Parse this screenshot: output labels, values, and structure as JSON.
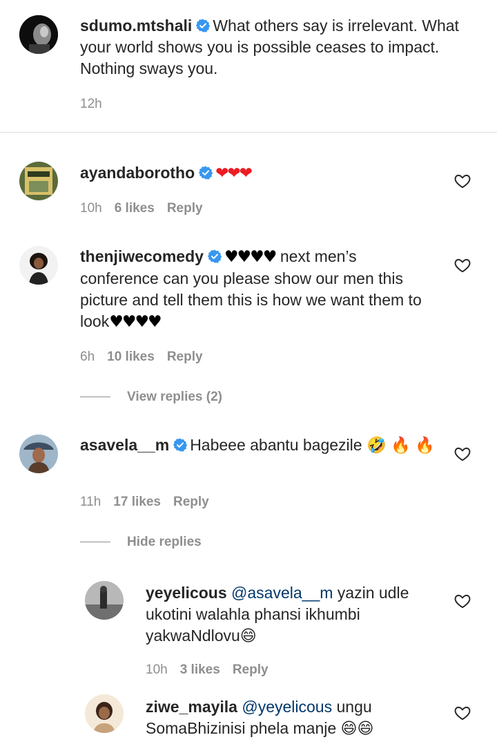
{
  "caption": {
    "username": "sdumo.mtshali",
    "text": "What others say is irrelevant. What your world shows you is possible ceases to impact. Nothing sways you.",
    "time": "12h"
  },
  "comments": [
    {
      "username": "ayandaborotho",
      "hearts": "❤❤❤",
      "time": "10h",
      "likes": "6 likes",
      "reply": "Reply"
    },
    {
      "username": "thenjiwecomedy",
      "hearts_before": "♥♥♥♥",
      "text": "next men’s conference can you please show our men this picture and tell them this is how we want them to look",
      "hearts_after": "♥♥♥♥",
      "time": "6h",
      "likes": "10 likes",
      "reply": "Reply",
      "thread_toggle": "View replies (2)"
    },
    {
      "username": "asavela__m",
      "text": "Habeee abantu bagezile",
      "emoji_1": "🤣",
      "emoji_2": "🔥",
      "emoji_3": "🔥",
      "time": "11h",
      "likes": "17 likes",
      "reply": "Reply",
      "thread_toggle": "Hide replies"
    }
  ],
  "replies": [
    {
      "username": "yeyelicous",
      "mention": "@asavela__m",
      "text": "yazin udle ukotini walahla phansi ikhumbi yakwaNdlovu",
      "emoji": "😄",
      "time": "10h",
      "likes": "3 likes",
      "reply": "Reply"
    },
    {
      "username": "ziwe_mayila",
      "mention": "@yeyelicous",
      "text": "ungu SomaBhizinisi phela manje",
      "emoji": "😄😄"
    }
  ],
  "colors": {
    "verified": "#3897f0",
    "mention": "#00376b",
    "meta": "#8e8e8e",
    "red_heart": "#ed1c24"
  },
  "icons": {
    "verified": "verified-badge-icon",
    "like": "heart-outline-icon"
  }
}
